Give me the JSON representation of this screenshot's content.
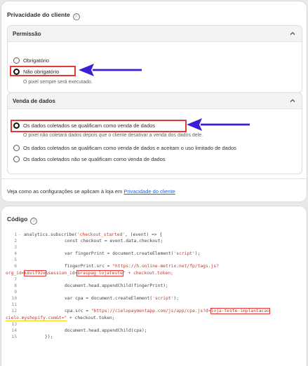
{
  "privacy": {
    "title": "Privacidade do cliente",
    "info_icon": "ⓘ",
    "permission": {
      "heading": "Permissão",
      "options": [
        "Obrigatório",
        "Não obrigatório"
      ],
      "selected": "Não obrigatório",
      "note": "O pixel sempre será executado."
    },
    "sales": {
      "heading": "Venda de dados",
      "options": [
        "Os dados coletados se qualificam como venda de dados",
        "Os dados coletados se qualificam como venda de dados e aceitam o uso limitado de dados",
        "Os dados coletados não se qualificam como venda de dados"
      ],
      "selected": "Os dados coletados se qualificam como venda de dados",
      "note": "O pixel não coletará dados depois que o cliente desativar a venda dos dados dele."
    },
    "footer_prefix": "Veja como as configurações se aplicam à loja em ",
    "footer_link": "Privacidade do cliente"
  },
  "code": {
    "title": "Código",
    "lines": {
      "l1a": "analytics.subscribe(",
      "l1b": "'checkout_started'",
      "l1c": ", (event) => {",
      "l2": "const checkout = event.data.checkout;",
      "l4a": "var fingerPrint = document.createElement(",
      "l4b": "'script'",
      "l4c": ");",
      "l6a": "fingerPrint.src = ",
      "l6b": "\"https://h.online-metrix.net/fp/tags.js?",
      "l6w1": "org_id=",
      "l6w2": "k8vif92e",
      "l6w3": "&session_id=",
      "l6w4": "braspag_lojateste",
      "l6w5": "\" + checkout.token;",
      "l8": "document.head.appendChild(fingerPrint);",
      "l10a": "var cpa = document.createElement(",
      "l10b": "'script'",
      "l10c": ");",
      "l12a": "cpa.src = ",
      "l12b": "\"https://cielopaymentapp.com/js/app/cpa.js?d=",
      "l12c": "loja-teste-implantacao",
      "l12w1": "cielo.myshopify.com&t=\"",
      "l12w2": " + checkout.token;",
      "l14": "document.head.appendChild(cpa);",
      "l15": "});"
    },
    "line_numbers": [
      "1",
      "2",
      "3",
      "4",
      "5",
      "6",
      "7",
      "8",
      "9",
      "10",
      "11",
      "12",
      "13",
      "14",
      "15"
    ]
  },
  "colors": {
    "highlight": "#e53935",
    "arrow": "#3a1fd6",
    "link": "#2463d1"
  }
}
